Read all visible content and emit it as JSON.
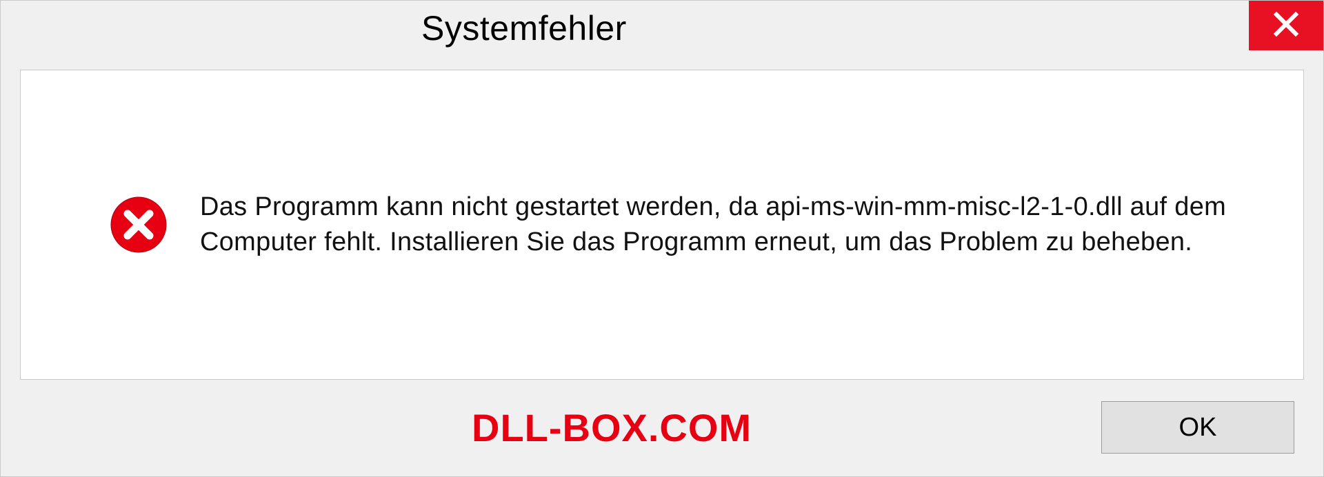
{
  "dialog": {
    "title": "Systemfehler",
    "message": "Das Programm kann nicht gestartet werden, da api-ms-win-mm-misc-l2-1-0.dll auf dem Computer fehlt. Installieren Sie das Programm erneut, um das Problem zu beheben.",
    "ok_label": "OK"
  },
  "watermark": "DLL-BOX.COM",
  "colors": {
    "close_bg": "#e81123",
    "error_icon": "#e60012",
    "watermark": "#e60012"
  }
}
